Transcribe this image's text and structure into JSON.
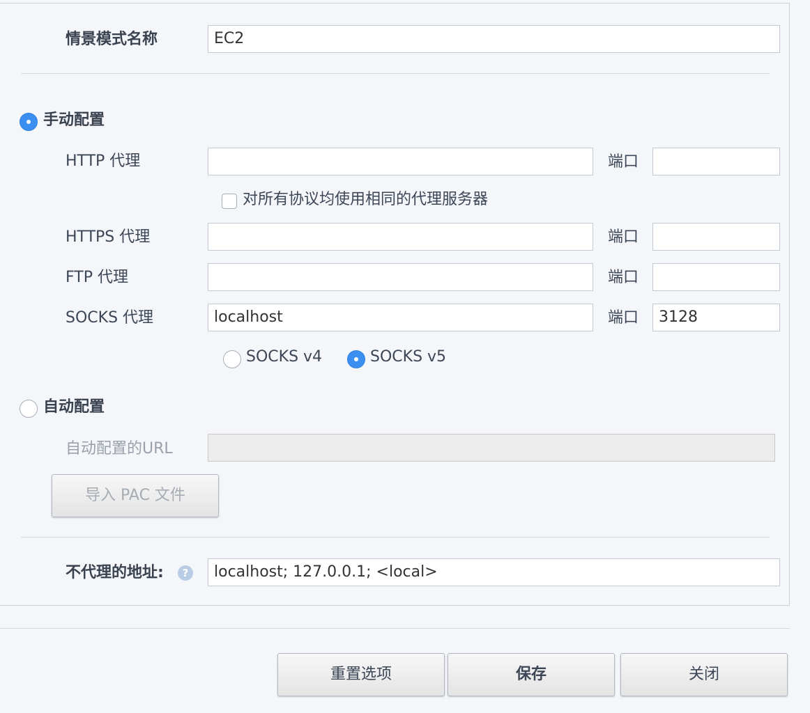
{
  "profile": {
    "name_label": "情景模式名称",
    "name_value": "EC2"
  },
  "manual": {
    "label": "手动配置",
    "selected": true,
    "port_label": "端口",
    "http": {
      "label": "HTTP 代理",
      "value": "",
      "port": ""
    },
    "same_for_all": {
      "label": "对所有协议均使用相同的代理服务器",
      "checked": false
    },
    "https": {
      "label": "HTTPS 代理",
      "value": "",
      "port": ""
    },
    "ftp": {
      "label": "FTP 代理",
      "value": "",
      "port": ""
    },
    "socks": {
      "label": "SOCKS 代理",
      "value": "localhost",
      "port": "3128"
    },
    "socks_v4": {
      "label": "SOCKS v4",
      "selected": false
    },
    "socks_v5": {
      "label": "SOCKS v5",
      "selected": true
    }
  },
  "auto": {
    "label": "自动配置",
    "selected": false,
    "url_label": "自动配置的URL",
    "url_value": "",
    "import_pac_label": "导入 PAC 文件"
  },
  "no_proxy": {
    "label": "不代理的地址:",
    "help_icon": "question-icon",
    "help_glyph": "?",
    "value": "localhost; 127.0.0.1; <local>"
  },
  "footer": {
    "reset_label": "重置选项",
    "save_label": "保存",
    "close_label": "关闭"
  },
  "colors": {
    "accent": "#3b8ff0",
    "background": "#f4f6f9",
    "border": "#c9d1dc"
  }
}
